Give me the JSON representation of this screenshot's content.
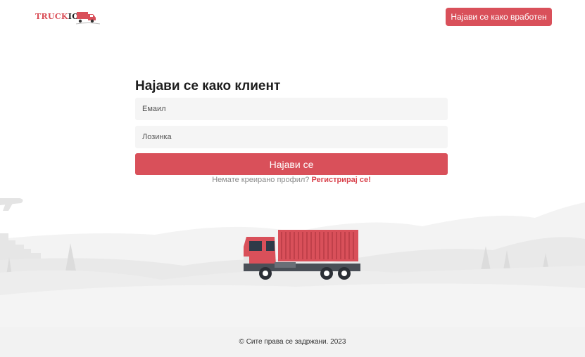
{
  "header": {
    "logo": {
      "text_main": "TRUCK",
      "text_accent": "IO"
    },
    "employee_login_label": "Најави се како вработен"
  },
  "form": {
    "title": "Најави се како клиент",
    "email_placeholder": "Емаил",
    "password_placeholder": "Лозинка",
    "login_button_label": "Најави се",
    "no_profile_text": "Немате креирано профил?",
    "register_link_label": "Регистрирај се!"
  },
  "footer": {
    "copyright": "© Сите права се задржани. 2023"
  },
  "colors": {
    "accent": "#d9505a",
    "footer_bg": "#f2f2f2",
    "field_bg": "#f5f5f5"
  }
}
